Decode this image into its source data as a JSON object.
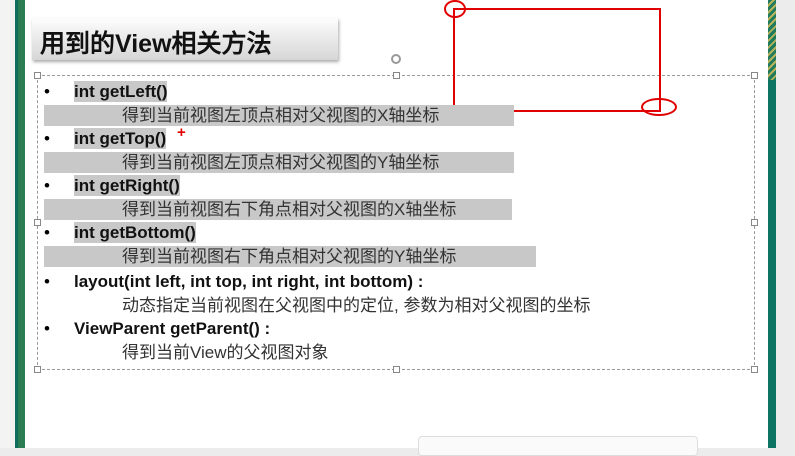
{
  "slide": {
    "title": "用到的View相关方法",
    "items": [
      {
        "code": "int getLeft()",
        "desc": "得到当前视图左顶点相对父视图的X轴坐标",
        "highlighted": true
      },
      {
        "code": "int getTop()",
        "desc": "得到当前视图左顶点相对父视图的Y轴坐标",
        "highlighted": true
      },
      {
        "code": "int getRight()",
        "desc": "得到当前视图右下角点相对父视图的X轴坐标",
        "highlighted": true
      },
      {
        "code": "int getBottom()",
        "desc": "得到当前视图右下角点相对父视图的Y轴坐标",
        "highlighted": true
      },
      {
        "code": "layout(int left, int top, int right, int bottom) :",
        "desc": "动态指定当前视图在父视图中的定位, 参数为相对父视图的坐标",
        "highlighted": false
      },
      {
        "code": "ViewParent getParent() :",
        "desc": "得到当前View的父视图对象",
        "highlighted": false
      }
    ],
    "bullet": "•",
    "cursor_mark": "+"
  },
  "colors": {
    "annotation": "#e00000",
    "highlight": "#c8c8c8",
    "accent": "#0d7464"
  }
}
